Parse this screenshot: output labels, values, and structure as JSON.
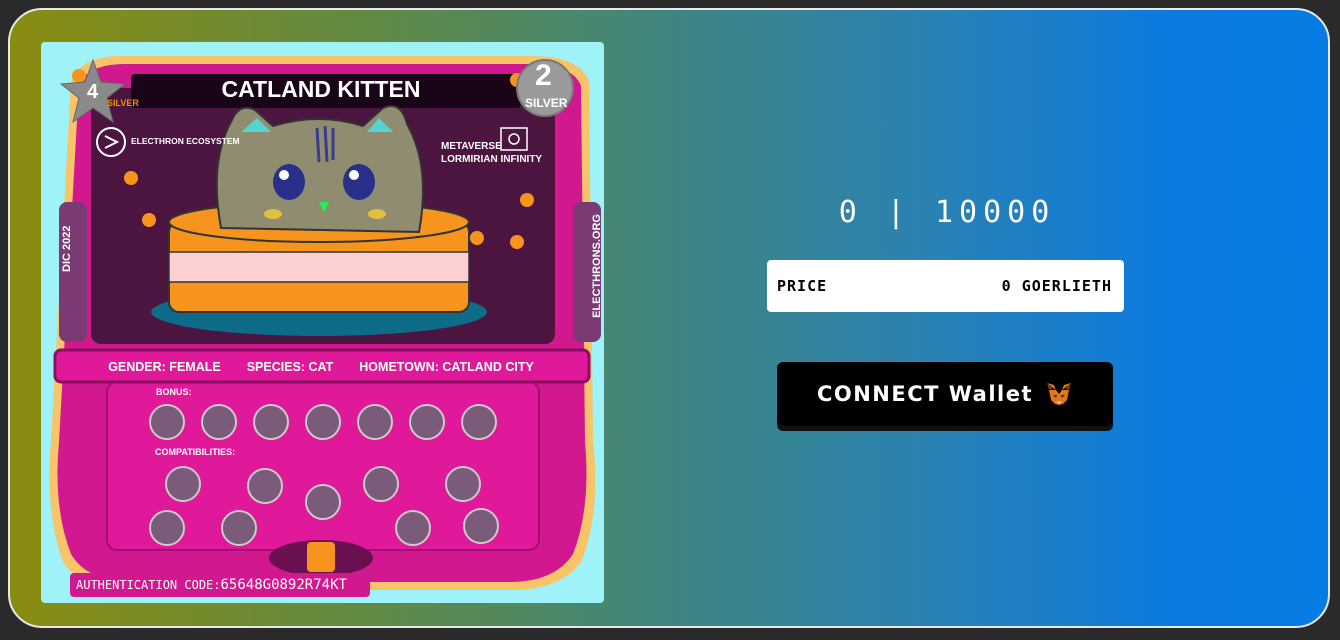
{
  "card": {
    "title": "CATLAND KITTEN",
    "rank_left": "4",
    "rank_left_sub": "SILVER",
    "rank_right": "2",
    "rank_right_sub": "SILVER",
    "ecosystem": "ELECTHRON ECOSYSTEM",
    "metaverse": "METAVERSE\nLORMIRIAN INFINITY",
    "date": "DIC 2022",
    "site": "ELECTHRONS.ORG",
    "gender": "GENDER: FEMALE",
    "species": "SPECIES: CAT",
    "hometown": "HOMETOWN: CATLAND CITY",
    "bonus_label": "BONUS:",
    "compat_label": "COMPATIBILITIES:",
    "auth_label": "AUTHENTICATION CODE:",
    "auth_code": "65648G0892R74KT"
  },
  "mint": {
    "counter": "0 | 10000",
    "price_label": "PRICE",
    "price_value": "0 GOERLIETH",
    "connect_label": "CONNECT Wallet"
  },
  "colors": {
    "card_magenta": "#d1188f",
    "card_dark": "#4b1540",
    "card_bg": "#9ef2f8",
    "button_bg": "#000000"
  },
  "icons": [
    "star-badge-icon",
    "silver-medal-icon",
    "electhron-logo-icon",
    "metaverse-eye-icon",
    "paw-icon",
    "metamask-fox-icon"
  ]
}
